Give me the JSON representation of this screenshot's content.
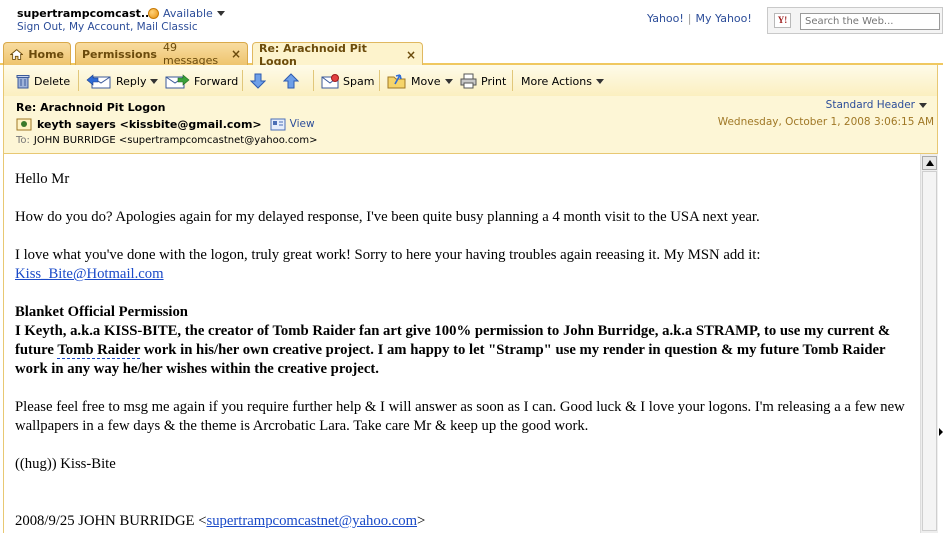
{
  "user": {
    "name": "supertrampcomcast...",
    "status": "Available",
    "links": "Sign Out, My Account, Mail Classic"
  },
  "yahoo_links": {
    "yahoo": "Yahoo!",
    "separator": "|",
    "my_yahoo": "My Yahoo!"
  },
  "search": {
    "logo_text": "Y!",
    "placeholder": "Search the Web..."
  },
  "tabs": [
    {
      "label": "Home"
    },
    {
      "label": "Permissions",
      "count": "49 messages",
      "close": "×"
    },
    {
      "label": "Re: Arachnoid Pit Logon",
      "close": "×"
    }
  ],
  "toolbar": {
    "delete": "Delete",
    "reply": "Reply",
    "forward": "Forward",
    "spam": "Spam",
    "move": "Move",
    "print": "Print",
    "more_actions": "More Actions"
  },
  "message": {
    "subject": "Re: Arachnoid Pit Logon",
    "from": "keyth sayers <kissbite@gmail.com>",
    "view_label": "View",
    "to_label": "To:",
    "to": "JOHN BURRIDGE <supertrampcomcastnet@yahoo.com>",
    "header_mode": "Standard Header",
    "date": "Wednesday, October 1, 2008 3:06:15 AM",
    "body": {
      "greeting": "Hello Mr",
      "para1": "How do you do? Apologies again for my delayed response, I've been quite busy planning a 4 month visit to the USA next year.",
      "para2_line1": "I love what you've done with the logon, truly great work! Sorry to here your having troubles again reeasing it. My MSN add it:",
      "msn_email": "Kiss_Bite@Hotmail.com",
      "permission_title": "Blanket Official Permission",
      "permission_part1": "I Keyth, a.k.a KISS-BITE, the creator of Tomb Raider fan art give 100% permission to John Burridge, a.k.a STRAMP, to use my current & future ",
      "permission_link": "Tomb Raider",
      "permission_part2": " work in his/her own creative project. I am happy to let \"Stramp\" use my render in question & my future Tomb Raider work  in any way he/her wishes within the creative project.",
      "para4": "Please feel free to msg me again if you require further help & I will answer as soon as I can. Good luck & I love your logons. I'm releasing a a few new wallpapers in a few days & the theme is Arcrobatic Lara. Take care Mr & keep up the good work.",
      "signoff": "((hug)) Kiss-Bite",
      "quoted_prefix": "2008/9/25 JOHN BURRIDGE <",
      "quoted_email": "supertrampcomcastnet@yahoo.com",
      "quoted_suffix": ">"
    }
  },
  "colors": {
    "accent_tab": "#eec46e",
    "toolbar_bg": "#fbefc0",
    "header_bg": "#fdf6d6",
    "link": "#2c4d99",
    "date": "#a07826"
  }
}
